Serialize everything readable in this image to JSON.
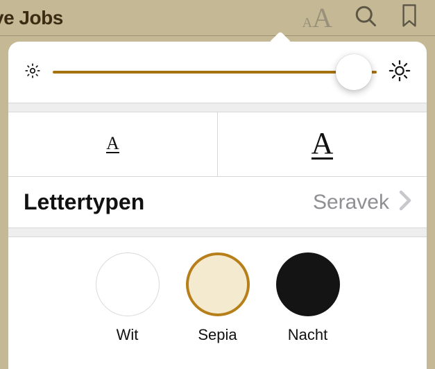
{
  "header": {
    "title": "ve Jobs"
  },
  "popover": {
    "brightness": {
      "value_percent": 93
    },
    "size": {
      "smaller_label": "A",
      "larger_label": "A"
    },
    "fonts": {
      "label": "Lettertypen",
      "current": "Seravek"
    },
    "themes": [
      {
        "id": "wit",
        "label": "Wit"
      },
      {
        "id": "sepia",
        "label": "Sepia"
      },
      {
        "id": "nacht",
        "label": "Nacht"
      }
    ]
  }
}
